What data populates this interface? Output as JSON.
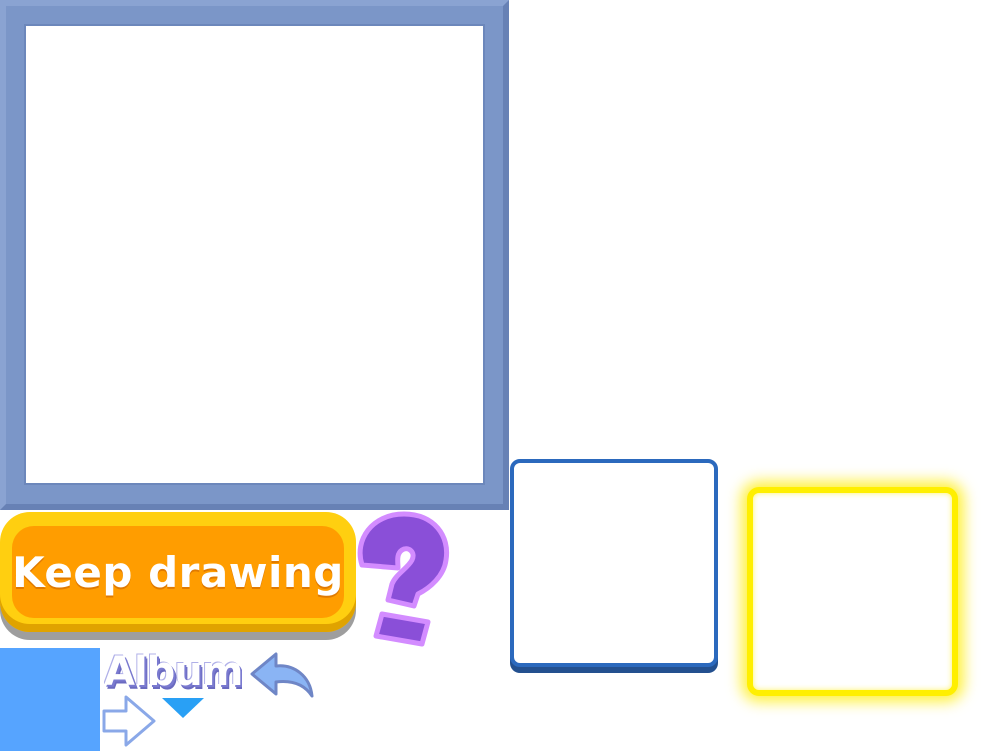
{
  "canvas": {
    "frame_color": "#7b96c8",
    "paper_color": "#ffffff"
  },
  "buttons": {
    "keep_drawing_label": "Keep drawing",
    "keep_drawing_color": "#ff9d00",
    "keep_drawing_border_color": "#ffcf10"
  },
  "album": {
    "title": "Album",
    "icons": {
      "help": "question-mark-icon",
      "back": "curved-back-arrow-icon",
      "next": "right-arrow-icon",
      "down": "down-triangle-icon"
    }
  },
  "slots": {
    "blue_border_color": "#2b69bd",
    "selected_border_color": "#ffef00"
  },
  "colors": {
    "help_purple": "#8a4fd8",
    "help_outline": "#d38cff",
    "accent_blue": "#56a4ff"
  }
}
